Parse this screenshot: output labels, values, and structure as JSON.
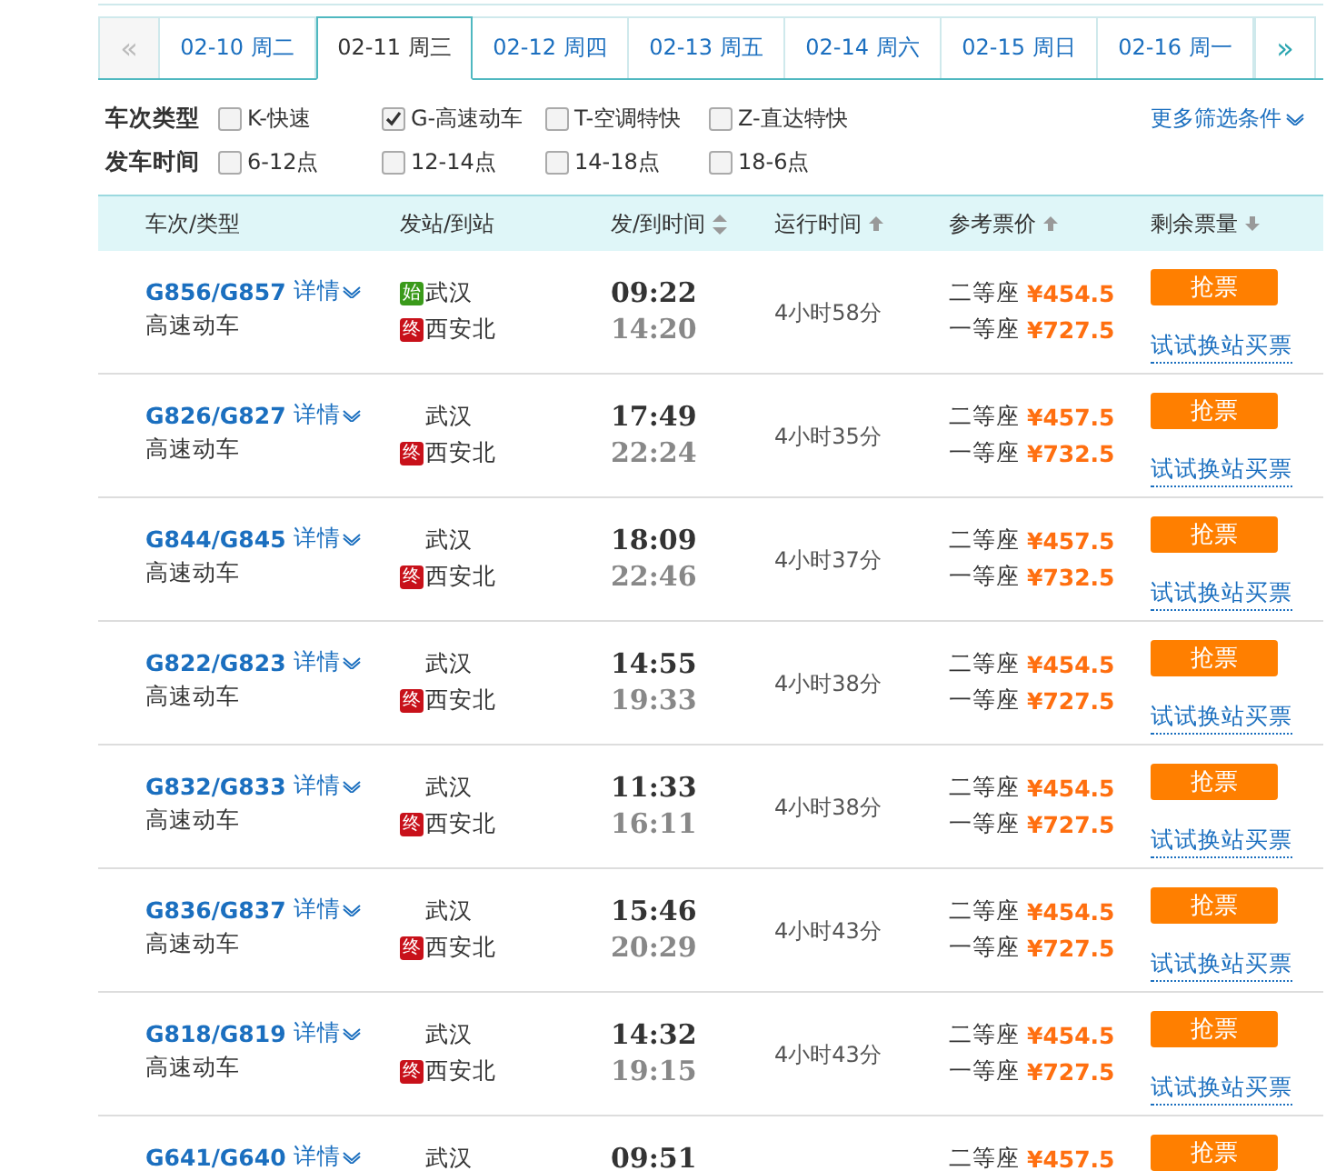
{
  "date_tabs": {
    "prev_arrow": "«",
    "next_arrow": "»",
    "tabs": [
      {
        "label": "02-10 周二",
        "selected": false
      },
      {
        "label": "02-11 周三",
        "selected": true
      },
      {
        "label": "02-12 周四",
        "selected": false
      },
      {
        "label": "02-13 周五",
        "selected": false
      },
      {
        "label": "02-14 周六",
        "selected": false
      },
      {
        "label": "02-15 周日",
        "selected": false
      },
      {
        "label": "02-16 周一",
        "selected": false
      }
    ]
  },
  "filters": {
    "more_link": "更多筛选条件",
    "groups": [
      {
        "label": "车次类型",
        "options": [
          {
            "label": "K-快速",
            "checked": false
          },
          {
            "label": "G-高速动车",
            "checked": true
          },
          {
            "label": "T-空调特快",
            "checked": false
          },
          {
            "label": "Z-直达特快",
            "checked": false
          }
        ]
      },
      {
        "label": "发车时间",
        "options": [
          {
            "label": "6-12点",
            "checked": false
          },
          {
            "label": "12-14点",
            "checked": false
          },
          {
            "label": "14-18点",
            "checked": false
          },
          {
            "label": "18-6点",
            "checked": false
          }
        ]
      }
    ]
  },
  "table": {
    "columns": [
      {
        "label": "车次/类型",
        "kind": "plain"
      },
      {
        "label": "发站/到站",
        "kind": "plain"
      },
      {
        "label": "发/到时间",
        "kind": "sort-both"
      },
      {
        "label": "运行时间",
        "kind": "sort-up"
      },
      {
        "label": "参考票价",
        "kind": "sort-up"
      },
      {
        "label": "剩余票量",
        "kind": "sort-down"
      }
    ],
    "rows": [
      {
        "train": "G856/G857",
        "details": "详情",
        "type": "高速动车",
        "from_badge": "始",
        "from": "武汉",
        "to_badge": "终",
        "to": "西安北",
        "depart": "09:22",
        "arrive": "14:20",
        "duration": "4小时58分",
        "prices": [
          {
            "seat": "二等座",
            "price": "¥454.5"
          },
          {
            "seat": "一等座",
            "price": "¥727.5"
          }
        ],
        "button": "抢票",
        "link": "试试换站买票"
      },
      {
        "train": "G826/G827",
        "details": "详情",
        "type": "高速动车",
        "from": "武汉",
        "to_badge": "终",
        "to": "西安北",
        "depart": "17:49",
        "arrive": "22:24",
        "duration": "4小时35分",
        "prices": [
          {
            "seat": "二等座",
            "price": "¥457.5"
          },
          {
            "seat": "一等座",
            "price": "¥732.5"
          }
        ],
        "button": "抢票",
        "link": "试试换站买票"
      },
      {
        "train": "G844/G845",
        "details": "详情",
        "type": "高速动车",
        "from": "武汉",
        "to_badge": "终",
        "to": "西安北",
        "depart": "18:09",
        "arrive": "22:46",
        "duration": "4小时37分",
        "prices": [
          {
            "seat": "二等座",
            "price": "¥457.5"
          },
          {
            "seat": "一等座",
            "price": "¥732.5"
          }
        ],
        "button": "抢票",
        "link": "试试换站买票"
      },
      {
        "train": "G822/G823",
        "details": "详情",
        "type": "高速动车",
        "from": "武汉",
        "to_badge": "终",
        "to": "西安北",
        "depart": "14:55",
        "arrive": "19:33",
        "duration": "4小时38分",
        "prices": [
          {
            "seat": "二等座",
            "price": "¥454.5"
          },
          {
            "seat": "一等座",
            "price": "¥727.5"
          }
        ],
        "button": "抢票",
        "link": "试试换站买票"
      },
      {
        "train": "G832/G833",
        "details": "详情",
        "type": "高速动车",
        "from": "武汉",
        "to_badge": "终",
        "to": "西安北",
        "depart": "11:33",
        "arrive": "16:11",
        "duration": "4小时38分",
        "prices": [
          {
            "seat": "二等座",
            "price": "¥454.5"
          },
          {
            "seat": "一等座",
            "price": "¥727.5"
          }
        ],
        "button": "抢票",
        "link": "试试换站买票"
      },
      {
        "train": "G836/G837",
        "details": "详情",
        "type": "高速动车",
        "from": "武汉",
        "to_badge": "终",
        "to": "西安北",
        "depart": "15:46",
        "arrive": "20:29",
        "duration": "4小时43分",
        "prices": [
          {
            "seat": "二等座",
            "price": "¥454.5"
          },
          {
            "seat": "一等座",
            "price": "¥727.5"
          }
        ],
        "button": "抢票",
        "link": "试试换站买票"
      },
      {
        "train": "G818/G819",
        "details": "详情",
        "type": "高速动车",
        "from": "武汉",
        "to_badge": "终",
        "to": "西安北",
        "depart": "14:32",
        "arrive": "19:15",
        "duration": "4小时43分",
        "prices": [
          {
            "seat": "二等座",
            "price": "¥454.5"
          },
          {
            "seat": "一等座",
            "price": "¥727.5"
          }
        ],
        "button": "抢票",
        "link": "试试换站买票"
      },
      {
        "train": "G641/G640",
        "details": "详情",
        "from": "武汉",
        "depart": "09:51",
        "prices": [
          {
            "seat": "二等座",
            "price": "¥457.5"
          }
        ],
        "button": "抢票"
      }
    ]
  }
}
